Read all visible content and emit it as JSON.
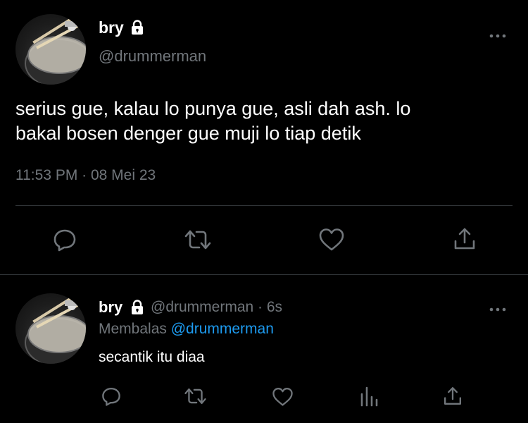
{
  "main_tweet": {
    "display_name": "bry",
    "handle": "@drummerman",
    "text_line1": "serius gue, kalau lo punya gue, asli dah ash. lo",
    "text_line2": "bakal bosen denger gue muji lo tiap detik",
    "timestamp": "11:53 PM · 08 Mei 23",
    "icons": {
      "lock": "lock-icon",
      "more": "more-icon",
      "reply": "reply-icon",
      "retweet": "retweet-icon",
      "like": "heart-icon",
      "share": "share-icon"
    }
  },
  "reply_tweet": {
    "display_name": "bry",
    "handle": "@drummerman",
    "time_ago": "· 6s",
    "replying_label": "Membalas",
    "replying_to": "@drummerman",
    "text": "secantik itu diaa",
    "icons": {
      "reply": "reply-icon",
      "retweet": "retweet-icon",
      "like": "heart-icon",
      "views": "views-icon",
      "share": "share-icon"
    }
  },
  "colors": {
    "background": "#000000",
    "text": "#ffffff",
    "secondary": "#71767b",
    "link": "#1d9bf0",
    "divider": "#2f3336"
  }
}
